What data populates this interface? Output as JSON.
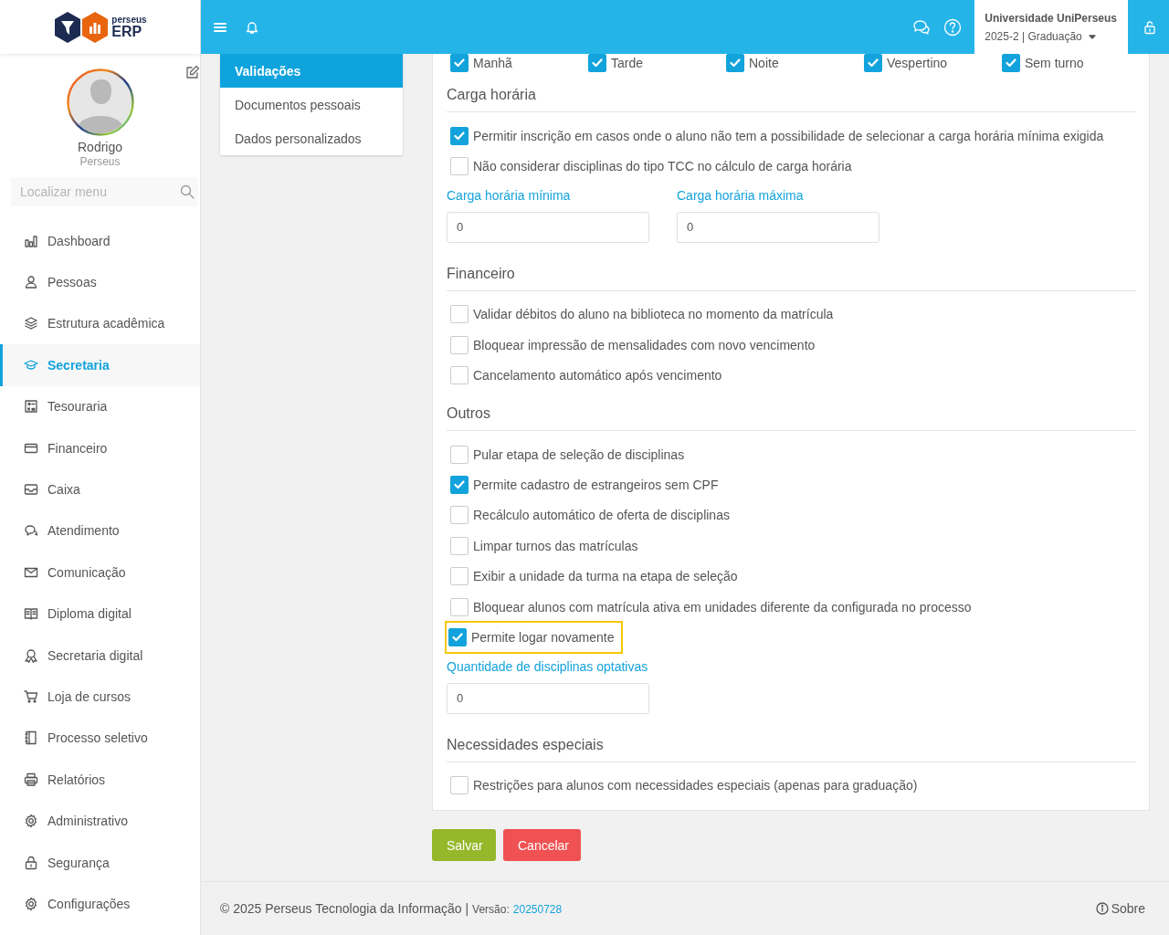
{
  "sidebar": {
    "logo": {
      "brand_small": "perseus",
      "brand": "ERP"
    },
    "user": {
      "name": "Rodrigo",
      "org": "Perseus"
    },
    "search": {
      "placeholder": "Localizar menu"
    },
    "items": [
      {
        "label": "Dashboard",
        "selected": false
      },
      {
        "label": "Pessoas",
        "selected": false
      },
      {
        "label": "Estrutura acadêmica",
        "selected": false
      },
      {
        "label": "Secretaria",
        "selected": true
      },
      {
        "label": "Tesouraria",
        "selected": false
      },
      {
        "label": "Financeiro",
        "selected": false
      },
      {
        "label": "Caixa",
        "selected": false
      },
      {
        "label": "Atendimento",
        "selected": false
      },
      {
        "label": "Comunicação",
        "selected": false
      },
      {
        "label": "Diploma digital",
        "selected": false
      },
      {
        "label": "Secretaria digital",
        "selected": false
      },
      {
        "label": "Loja de cursos",
        "selected": false
      },
      {
        "label": "Processo seletivo",
        "selected": false
      },
      {
        "label": "Relatórios",
        "selected": false
      },
      {
        "label": "Administrativo",
        "selected": false
      },
      {
        "label": "Segurança",
        "selected": false
      },
      {
        "label": "Configurações",
        "selected": false
      }
    ]
  },
  "topbar": {
    "institution": "Universidade UniPerseus",
    "period": "2025-2 | Graduação"
  },
  "submenu": [
    {
      "label": "Validações",
      "selected": true
    },
    {
      "label": "Documentos pessoais",
      "selected": false
    },
    {
      "label": "Dados personalizados",
      "selected": false
    }
  ],
  "form": {
    "shifts": [
      {
        "label": "Manhã",
        "checked": true
      },
      {
        "label": "Tarde",
        "checked": true
      },
      {
        "label": "Noite",
        "checked": true
      },
      {
        "label": "Vespertino",
        "checked": true
      },
      {
        "label": "Sem turno",
        "checked": true
      }
    ],
    "sections": [
      {
        "title": "Carga horária",
        "items": [
          {
            "kind": "checkbox",
            "label": "Permitir inscrição em casos onde o aluno não tem a possibilidade de selecionar a carga horária mínima exigida",
            "checked": true,
            "highlighted": false
          },
          {
            "kind": "checkbox",
            "label": "Não considerar disciplinas do tipo TCC no cálculo de carga horária",
            "checked": false,
            "highlighted": false
          },
          {
            "kind": "fields",
            "fields": [
              {
                "label": "Carga horária mínima",
                "value": "0"
              },
              {
                "label": "Carga horária máxima",
                "value": "0"
              }
            ]
          }
        ]
      },
      {
        "title": "Financeiro",
        "items": [
          {
            "kind": "checkbox",
            "label": "Validar débitos do aluno na biblioteca no momento da matrícula",
            "checked": false,
            "highlighted": false
          },
          {
            "kind": "checkbox",
            "label": "Bloquear impressão de mensalidades com novo vencimento",
            "checked": false,
            "highlighted": false
          },
          {
            "kind": "checkbox",
            "label": "Cancelamento automático após vencimento",
            "checked": false,
            "highlighted": false
          }
        ]
      },
      {
        "title": "Outros",
        "items": [
          {
            "kind": "checkbox",
            "label": "Pular etapa de seleção de disciplinas",
            "checked": false,
            "highlighted": false
          },
          {
            "kind": "checkbox",
            "label": "Permite cadastro de estrangeiros sem CPF",
            "checked": true,
            "highlighted": false
          },
          {
            "kind": "checkbox",
            "label": "Recálculo automático de oferta de disciplinas",
            "checked": false,
            "highlighted": false
          },
          {
            "kind": "checkbox",
            "label": "Limpar turnos das matrículas",
            "checked": false,
            "highlighted": false
          },
          {
            "kind": "checkbox",
            "label": "Exibir a unidade da turma na etapa de seleção",
            "checked": false,
            "highlighted": false
          },
          {
            "kind": "checkbox",
            "label": "Bloquear alunos com matrícula ativa em unidades diferente da configurada no processo",
            "checked": false,
            "highlighted": false
          },
          {
            "kind": "checkbox",
            "label": "Permite logar novamente",
            "checked": true,
            "highlighted": true
          },
          {
            "kind": "fields",
            "fields": [
              {
                "label": "Quantidade de disciplinas optativas",
                "value": "0"
              }
            ]
          }
        ]
      },
      {
        "title": "Necessidades especiais",
        "items": [
          {
            "kind": "checkbox",
            "label": "Restrições para alunos com necessidades especiais (apenas para graduação)",
            "checked": false,
            "highlighted": false
          }
        ]
      }
    ]
  },
  "actions": [
    {
      "label": "Salvar",
      "kind": "primary"
    },
    {
      "label": "Cancelar",
      "kind": "danger"
    }
  ],
  "footer": {
    "copyright": "© 2025 Perseus Tecnologia da Informação |",
    "version_label": "Versão:",
    "version": "20250728",
    "about": "Sobre"
  }
}
